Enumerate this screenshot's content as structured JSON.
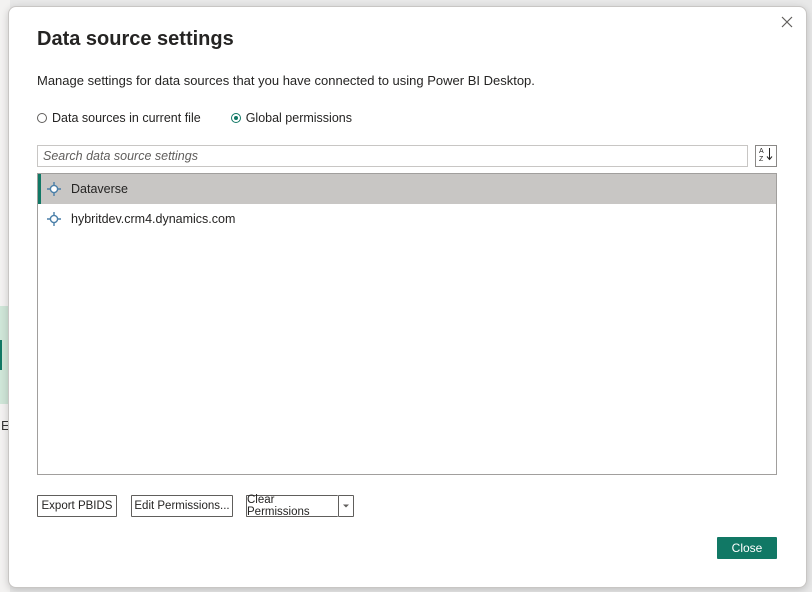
{
  "background": {
    "letter": "E"
  },
  "dialog": {
    "title": "Data source settings",
    "description": "Manage settings for data sources that you have connected to using Power BI Desktop.",
    "scope_options": [
      {
        "label": "Data sources in current file",
        "selected": false
      },
      {
        "label": "Global permissions",
        "selected": true
      }
    ],
    "search": {
      "placeholder": "Search data source settings",
      "value": ""
    },
    "sort_icon": "sort-az-icon",
    "sources": [
      {
        "label": "Dataverse",
        "selected": true,
        "icon": "data-source-icon"
      },
      {
        "label": "hybritdev.crm4.dynamics.com",
        "selected": false,
        "icon": "data-source-icon"
      }
    ],
    "buttons": {
      "export": "Export PBIDS",
      "edit": "Edit Permissions...",
      "clear": "Clear Permissions",
      "close": "Close"
    },
    "colors": {
      "accent": "#117865",
      "selected_row": "#c8c6c4"
    }
  }
}
